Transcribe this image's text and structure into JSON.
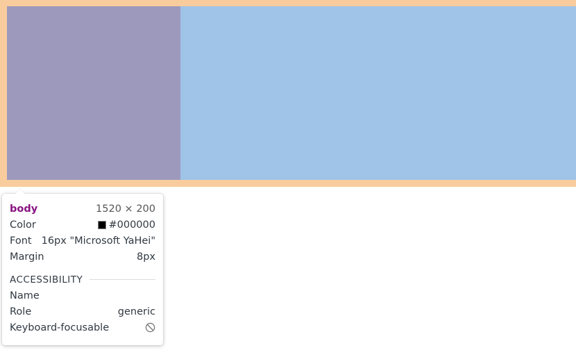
{
  "colors": {
    "margin_overlay": "#f9cc9d",
    "left_block": "#9d99bd",
    "right_block": "#a0c3e8",
    "tag_name": "#881280",
    "swatch": "#000000"
  },
  "tooltip": {
    "element": "body",
    "dimensions": "1520 × 200",
    "properties": [
      {
        "label": "Color",
        "value": "#000000",
        "has_swatch": true
      },
      {
        "label": "Font",
        "value": "16px \"Microsoft YaHei\""
      },
      {
        "label": "Margin",
        "value": "8px"
      }
    ],
    "accessibility": {
      "heading": "ACCESSIBILITY",
      "rows": [
        {
          "label": "Name",
          "value": ""
        },
        {
          "label": "Role",
          "value": "generic"
        },
        {
          "label": "Keyboard-focusable",
          "icon": "not-allowed-icon"
        }
      ]
    }
  }
}
